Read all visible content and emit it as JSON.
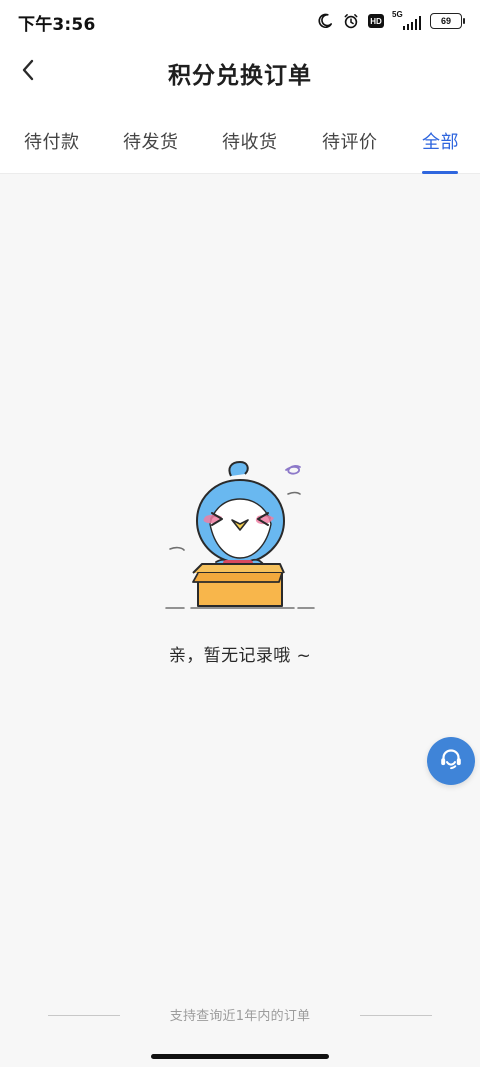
{
  "status_bar": {
    "time": "下午3:56",
    "hd_label": "HD",
    "network_label": "5G",
    "battery_level": "69",
    "icons": [
      "moon-icon",
      "alarm-clock-icon",
      "hd-icon",
      "signal-icon",
      "battery-icon"
    ]
  },
  "header": {
    "title": "积分兑换订单",
    "back_icon": "chevron-left-icon"
  },
  "tabs": [
    {
      "label": "待付款",
      "active": false
    },
    {
      "label": "待发货",
      "active": false
    },
    {
      "label": "待收货",
      "active": false
    },
    {
      "label": "待评价",
      "active": false
    },
    {
      "label": "全部",
      "active": true
    }
  ],
  "empty_state": {
    "message": "亲，暂无记录哦 ~",
    "illustration": "bird-in-box-illustration"
  },
  "floating_action": {
    "icon": "customer-service-icon"
  },
  "footer": {
    "note": "支持查询近1年内的订单"
  },
  "colors": {
    "accent": "#2f66de",
    "support_button": "#3f84d8",
    "page_background": "#f7f7f7",
    "box_orange": "#f8b64b",
    "bird_blue": "#69b8f0"
  }
}
